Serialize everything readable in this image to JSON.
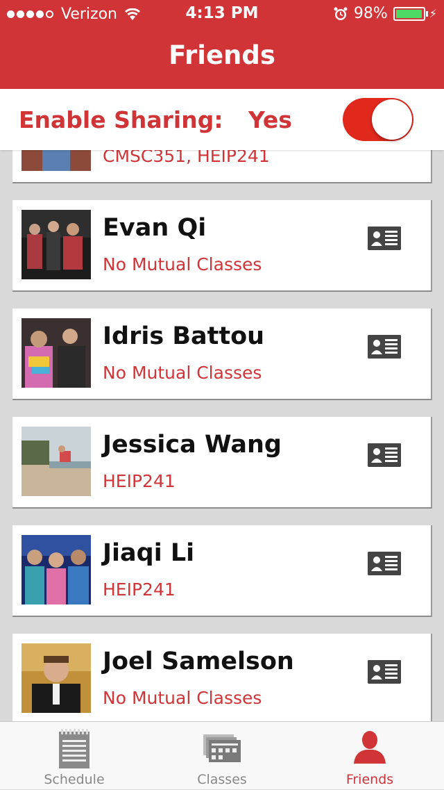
{
  "status_bar": {
    "carrier": "Verizon",
    "time": "4:13 PM",
    "battery": "98%",
    "battery_level": 0.98
  },
  "nav": {
    "title": "Friends"
  },
  "sharing": {
    "label": "Enable Sharing:",
    "value": "Yes",
    "toggle_on": true,
    "accent": "#d03437"
  },
  "friends": [
    {
      "name": "",
      "classes": "CMSC351, HEIP241"
    },
    {
      "name": "Evan Qi",
      "classes": "No Mutual Classes"
    },
    {
      "name": "Idris Battou",
      "classes": "No Mutual Classes"
    },
    {
      "name": "Jessica Wang",
      "classes": "HEIP241"
    },
    {
      "name": "Jiaqi Li",
      "classes": "HEIP241"
    },
    {
      "name": "Joel Samelson",
      "classes": "No Mutual Classes"
    }
  ],
  "tabs": [
    {
      "label": "Schedule",
      "icon": "notepad-icon"
    },
    {
      "label": "Classes",
      "icon": "classes-icon"
    },
    {
      "label": "Friends",
      "icon": "person-icon",
      "active": true
    }
  ]
}
